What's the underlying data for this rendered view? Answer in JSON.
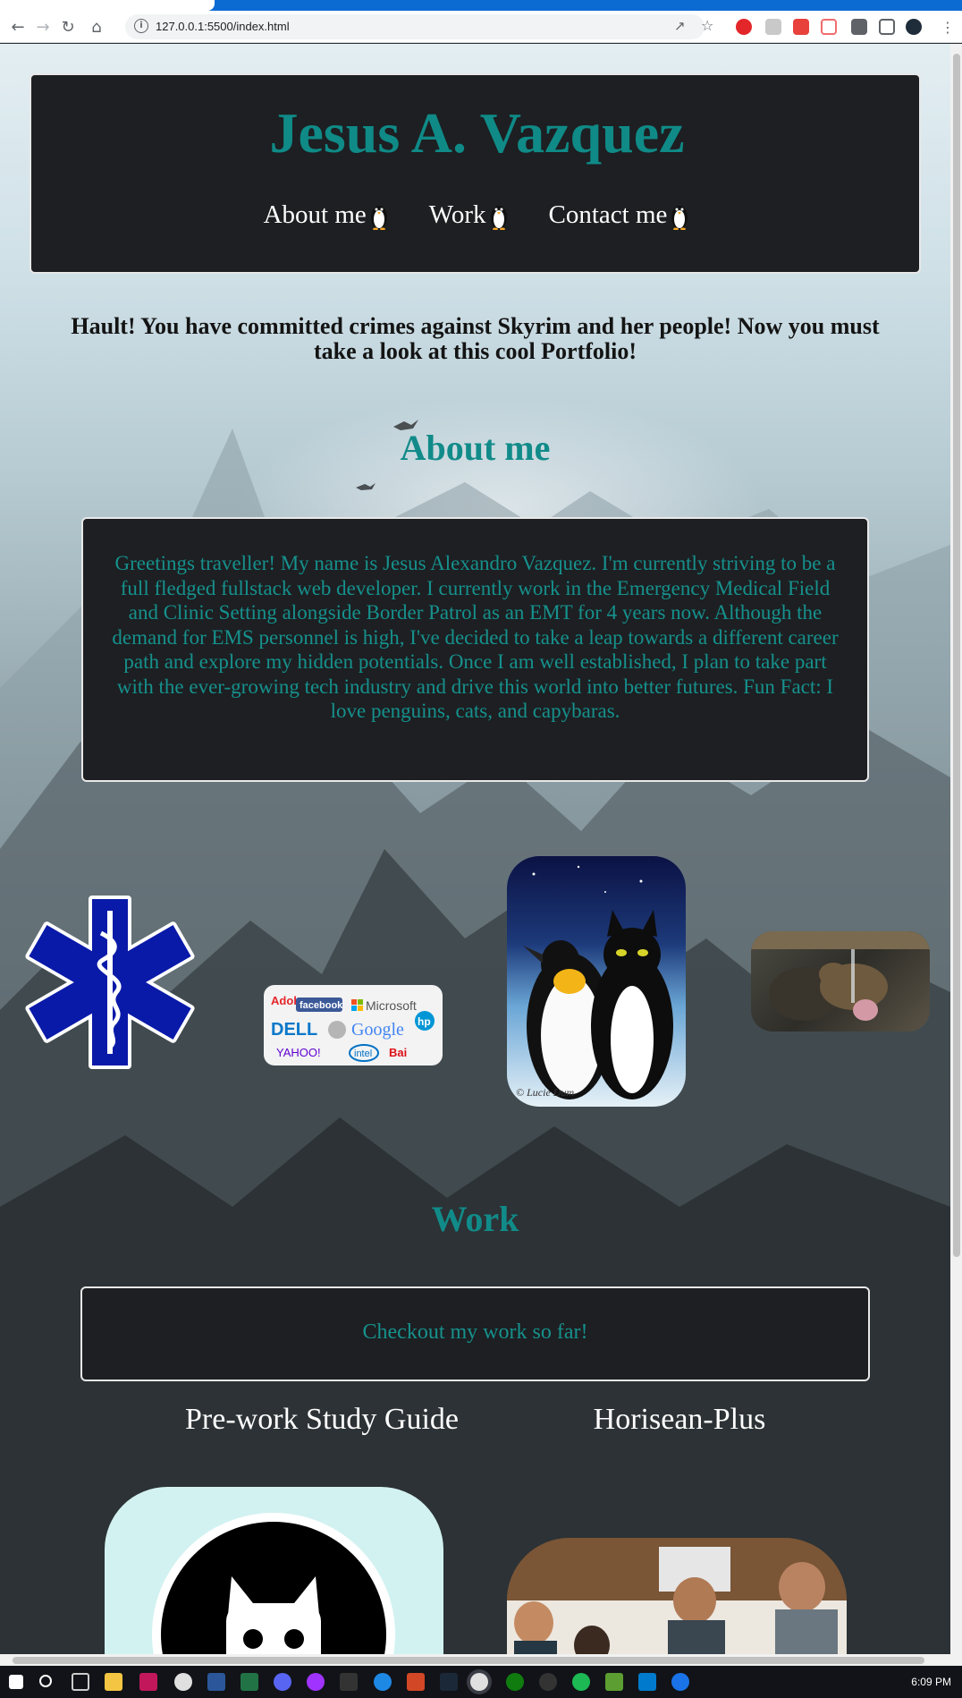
{
  "browser": {
    "url": "127.0.0.1:5500/index.html",
    "back_icon": "back-arrow-icon",
    "forward_icon": "forward-arrow-icon",
    "reload_icon": "reload-icon",
    "home_icon": "home-icon",
    "tab_accent": "#0b6bd3"
  },
  "header": {
    "title": "Jesus A. Vazquez",
    "nav": [
      {
        "label": "About me"
      },
      {
        "label": "Work"
      },
      {
        "label": "Contact me"
      }
    ],
    "title_color": "#0f8a87"
  },
  "intro": {
    "text": "Hault! You have committed crimes against Skyrim and her people! Now you must take a look at this cool Portfolio!"
  },
  "about": {
    "heading": "About me",
    "body": "Greetings traveller! My name is Jesus Alexandro Vazquez. I'm currently striving to be a full fledged fullstack web developer. I currently work in the Emergency Medical Field and Clinic Setting alongside Border Patrol as an EMT for 4 years now. Although the demand for EMS personnel is high, I've decided to take a leap towards a different career path and explore my hidden potentials. Once I am well established, I plan to take part with the ever-growing tech industry and drive this world into better futures. Fun Fact: I love penguins, cats, and capybaras.",
    "images": [
      "star-of-life-icon",
      "tech-companies-logos",
      "penguin-and-cat-painting",
      "capybara-photo"
    ]
  },
  "work": {
    "heading": "Work",
    "intro": "Checkout my work so far!",
    "projects": [
      {
        "title": "Pre-work Study Guide"
      },
      {
        "title": "Horisean-Plus"
      }
    ]
  },
  "taskbar": {
    "clock": "6:09 PM"
  }
}
